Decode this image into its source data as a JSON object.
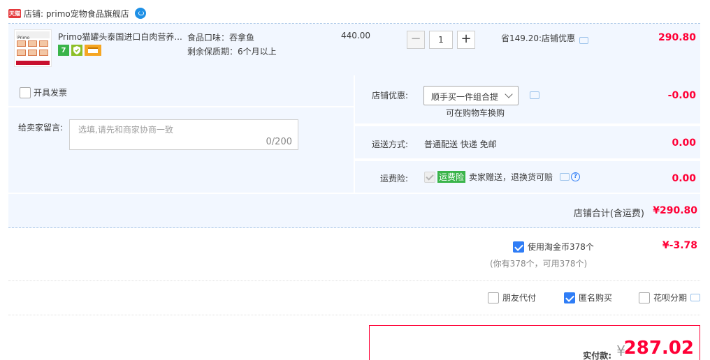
{
  "shop": {
    "badge": "天猫",
    "name": "店铺: primo宠物食品旗舰店",
    "thumb_brand": "Primo"
  },
  "item": {
    "title": "Primo猫罐头泰国进口白肉营养...",
    "sku_flavor": "食品口味：吞拿鱼",
    "sku_shelf_life": "剩余保质期：6个月以上",
    "unit_price": "440.00",
    "quantity": "1",
    "qty_minus": "−",
    "qty_plus": "+",
    "discount_text": "省149.20:店铺优惠",
    "total": "290.80",
    "badge_seven": "7"
  },
  "invoice": {
    "label": "开具发票"
  },
  "message": {
    "label": "给卖家留言:",
    "placeholder": "选填,请先和商家协商一致",
    "count": "0/200"
  },
  "shop_discount": {
    "label": "店铺优惠:",
    "select_value": "顺手买一件组合提",
    "note": "可在购物车换购",
    "value": "-0.00"
  },
  "shipping": {
    "label": "运送方式:",
    "method": "普通配送 快递 免邮",
    "value": "0.00"
  },
  "insurance": {
    "label": "运费险:",
    "tag": "运费险",
    "text": "卖家赠送，退换货可赔",
    "help": "?",
    "value": "0.00"
  },
  "subtotal": {
    "label": "店铺合计(含运费)",
    "value": "¥290.80"
  },
  "coins": {
    "label": "使用淘金币378个",
    "sub": "(你有378个，可用378个)",
    "value": "¥-3.78",
    "checked": true
  },
  "pay_options": {
    "friend_pay": "朋友代付",
    "anonymous": "匿名购买",
    "installment": "花呗分期"
  },
  "final": {
    "label": "实付款:",
    "currency": "¥",
    "amount": "287.02"
  },
  "colors": {
    "price_red": "#ff0036",
    "row_bg": "#f2f7ff",
    "checkbox_blue": "#2f7df6",
    "insurance_green": "#3ab44a"
  }
}
